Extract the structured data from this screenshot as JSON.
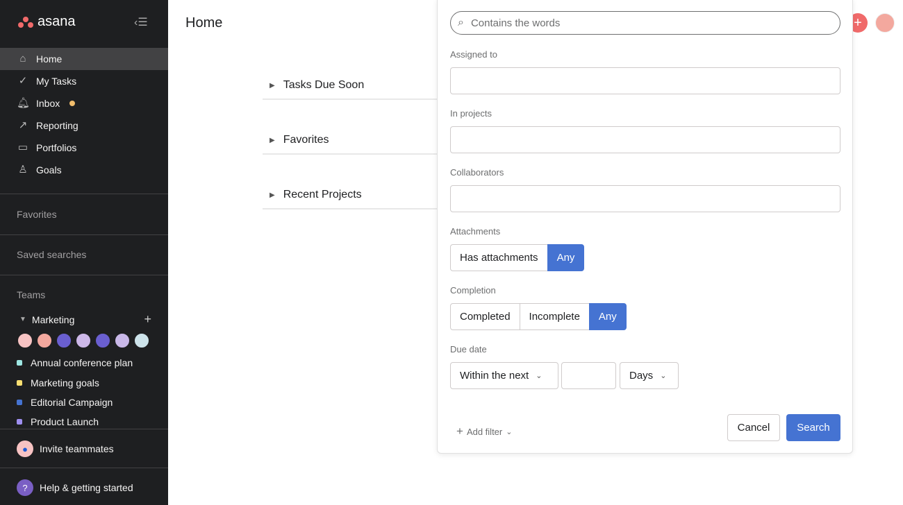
{
  "sidebar": {
    "logo": "asana",
    "nav": [
      {
        "label": "Home",
        "icon": "home-icon"
      },
      {
        "label": "My Tasks",
        "icon": "check-circle-icon"
      },
      {
        "label": "Inbox",
        "icon": "bell-icon"
      },
      {
        "label": "Reporting",
        "icon": "chart-line-icon"
      },
      {
        "label": "Portfolios",
        "icon": "portfolio-icon"
      },
      {
        "label": "Goals",
        "icon": "goals-icon"
      }
    ],
    "favorites": "Favorites",
    "saved_searches": "Saved searches",
    "teams": "Teams",
    "team": {
      "name": "Marketing",
      "avatar_colors": [
        "#f7c3c3",
        "#f3a89e",
        "#6a5fd0",
        "#cdb8e8",
        "#6a5fd0",
        "#c9b8e8",
        "#cde3ea"
      ]
    },
    "projects": [
      {
        "name": "Annual conference plan",
        "color": "#9ee7e3"
      },
      {
        "name": "Marketing goals",
        "color": "#f8df72"
      },
      {
        "name": "Editorial Campaign",
        "color": "#4573d2"
      },
      {
        "name": "Product Launch",
        "color": "#9e8ff0"
      }
    ],
    "invite": "Invite teammates",
    "help": "Help & getting started"
  },
  "main": {
    "title": "Home",
    "sections": [
      "Tasks Due Soon",
      "Favorites",
      "Recent Projects"
    ]
  },
  "search_panel": {
    "placeholder": "Contains the words",
    "assigned_to": "Assigned to",
    "in_projects": "In projects",
    "collaborators": "Collaborators",
    "attachments": {
      "label": "Attachments",
      "options": [
        "Has attachments",
        "Any"
      ],
      "selected": "Any"
    },
    "completion": {
      "label": "Completion",
      "options": [
        "Completed",
        "Incomplete",
        "Any"
      ],
      "selected": "Any"
    },
    "due_date": {
      "label": "Due date",
      "mode": "Within the next",
      "value": "",
      "unit": "Days"
    },
    "add_filter": "Add filter",
    "cancel": "Cancel",
    "search": "Search"
  },
  "colors": {
    "accent": "#4573d2",
    "brand": "#f06a6a"
  }
}
